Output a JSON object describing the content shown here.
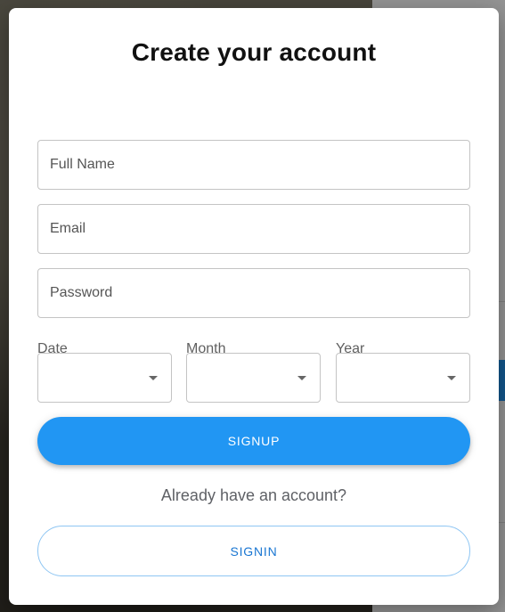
{
  "modal": {
    "title": "Create your account",
    "fields": {
      "full_name": {
        "placeholder": "Full Name",
        "value": ""
      },
      "email": {
        "placeholder": "Email",
        "value": ""
      },
      "password": {
        "placeholder": "Password",
        "value": ""
      }
    },
    "dob": {
      "date_label": "Date",
      "month_label": "Month",
      "year_label": "Year",
      "date_value": "",
      "month_value": "",
      "year_value": ""
    },
    "signup_label": "SIGNUP",
    "already_text": "Already have an account?",
    "signin_label": "SIGNIN"
  },
  "colors": {
    "primary": "#2196f3",
    "signin_text": "#1976d2",
    "overlay": "rgba(0,0,0,0.42)"
  }
}
